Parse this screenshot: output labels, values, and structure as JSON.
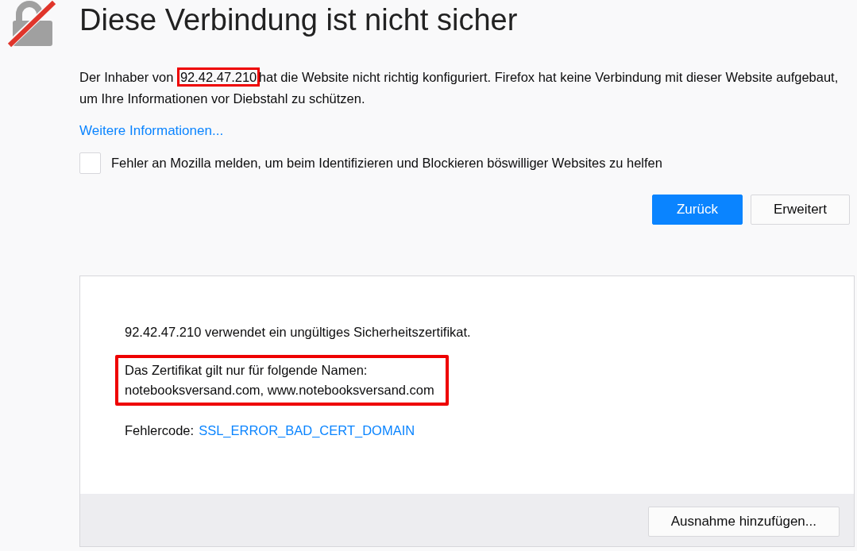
{
  "title": "Diese Verbindung ist nicht sicher",
  "intro": {
    "before": "Der Inhaber von",
    "highlighted": "92.42.47.210",
    "after": "hat die Website nicht richtig konfiguriert. Firefox hat keine Verbindung mit dieser Website aufgebaut, um Ihre Informationen vor Diebstahl zu schützen."
  },
  "more_info_link": "Weitere Informationen...",
  "report_checkbox": {
    "label": "Fehler an Mozilla melden, um beim Identifizieren und Blockieren böswilliger Websites zu helfen",
    "checked": false
  },
  "buttons": [
    {
      "label": "Zurück",
      "kind": "primary"
    },
    {
      "label": "Erweitert",
      "kind": "secondary"
    }
  ],
  "advanced": {
    "statement": "92.42.47.210 verwendet ein ungültiges Sicherheitszertifikat.",
    "highlighted_lines": [
      "Das Zertifikat gilt nur für folgende Namen:",
      "notebooksversand.com, www.notebooksversand.com"
    ],
    "error_label": "Fehlercode:",
    "error_code": "SSL_ERROR_BAD_CERT_DOMAIN",
    "exception_button": "Ausnahme hinzufügen..."
  }
}
